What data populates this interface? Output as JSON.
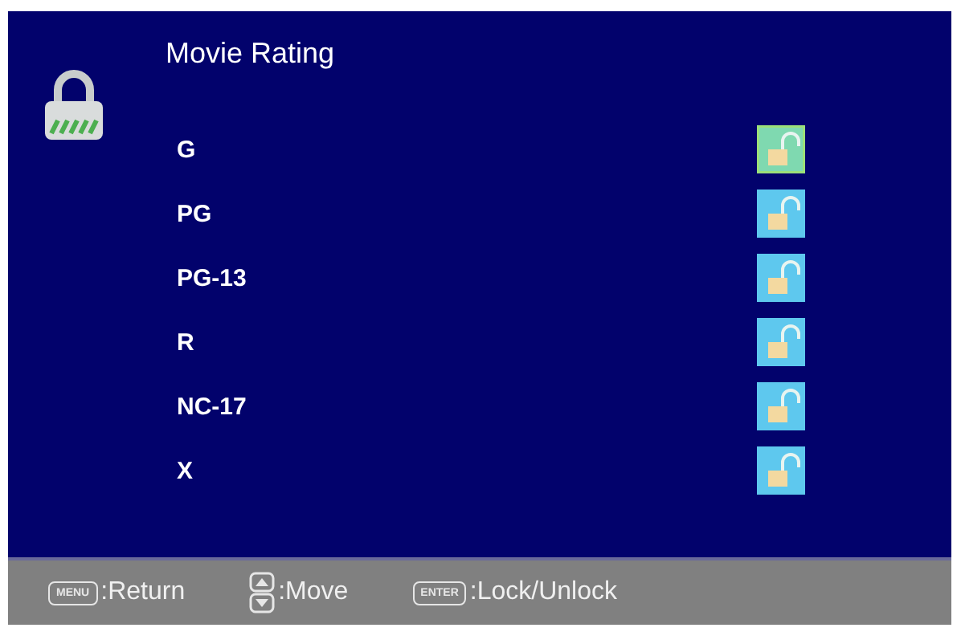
{
  "title": "Movie Rating",
  "ratings": [
    {
      "label": "G",
      "locked": false,
      "selected": true
    },
    {
      "label": "PG",
      "locked": false,
      "selected": false
    },
    {
      "label": "PG-13",
      "locked": false,
      "selected": false
    },
    {
      "label": "R",
      "locked": false,
      "selected": false
    },
    {
      "label": "NC-17",
      "locked": false,
      "selected": false
    },
    {
      "label": "X",
      "locked": false,
      "selected": false
    }
  ],
  "hints": [
    {
      "kind": "key",
      "key": "MENU",
      "text": ":Return"
    },
    {
      "kind": "updown",
      "text": ":Move"
    },
    {
      "kind": "key",
      "key": "ENTER",
      "text": ":Lock/Unlock"
    }
  ]
}
